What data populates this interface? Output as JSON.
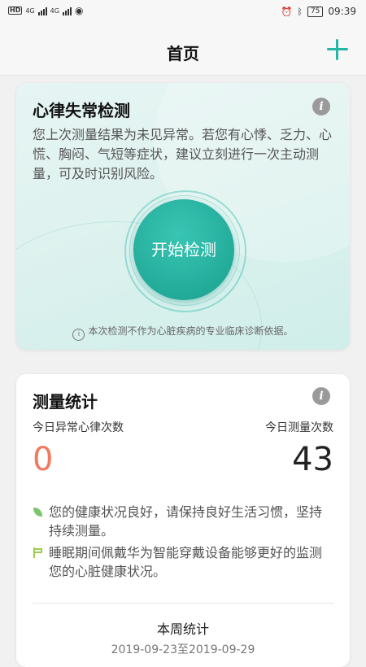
{
  "status_bar": {
    "network_left": "4G",
    "network_right": "4G",
    "battery": "75",
    "time": "09:39"
  },
  "header": {
    "title": "首页",
    "add_icon": "plus-icon"
  },
  "detect_card": {
    "title": "心律失常检测",
    "description": "您上次测量结果为未见异常。若您有心悸、乏力、心慌、胸闷、气短等症状，建议立刻进行一次主动测量，可及时识别风险。",
    "start_button": "开始检测",
    "disclaimer": "本次检测不作为心脏疾病的专业临床诊断依据。"
  },
  "stats_card": {
    "title": "测量统计",
    "abnormal_label": "今日异常心律次数",
    "abnormal_value": "0",
    "total_label": "今日测量次数",
    "total_value": "43",
    "tips": [
      {
        "icon": "leaf-icon",
        "text": "您的健康状况良好，请保持良好生活习惯，坚持持续测量。"
      },
      {
        "icon": "flag-icon",
        "text": "睡眠期间佩戴华为智能穿戴设备能够更好的监测您的心脏健康状况。"
      }
    ],
    "week_title": "本周统计",
    "week_range": "2019-09-23至2019-09-29"
  },
  "colors": {
    "accent": "#25b7a6",
    "abnormal": "#f0795e"
  }
}
